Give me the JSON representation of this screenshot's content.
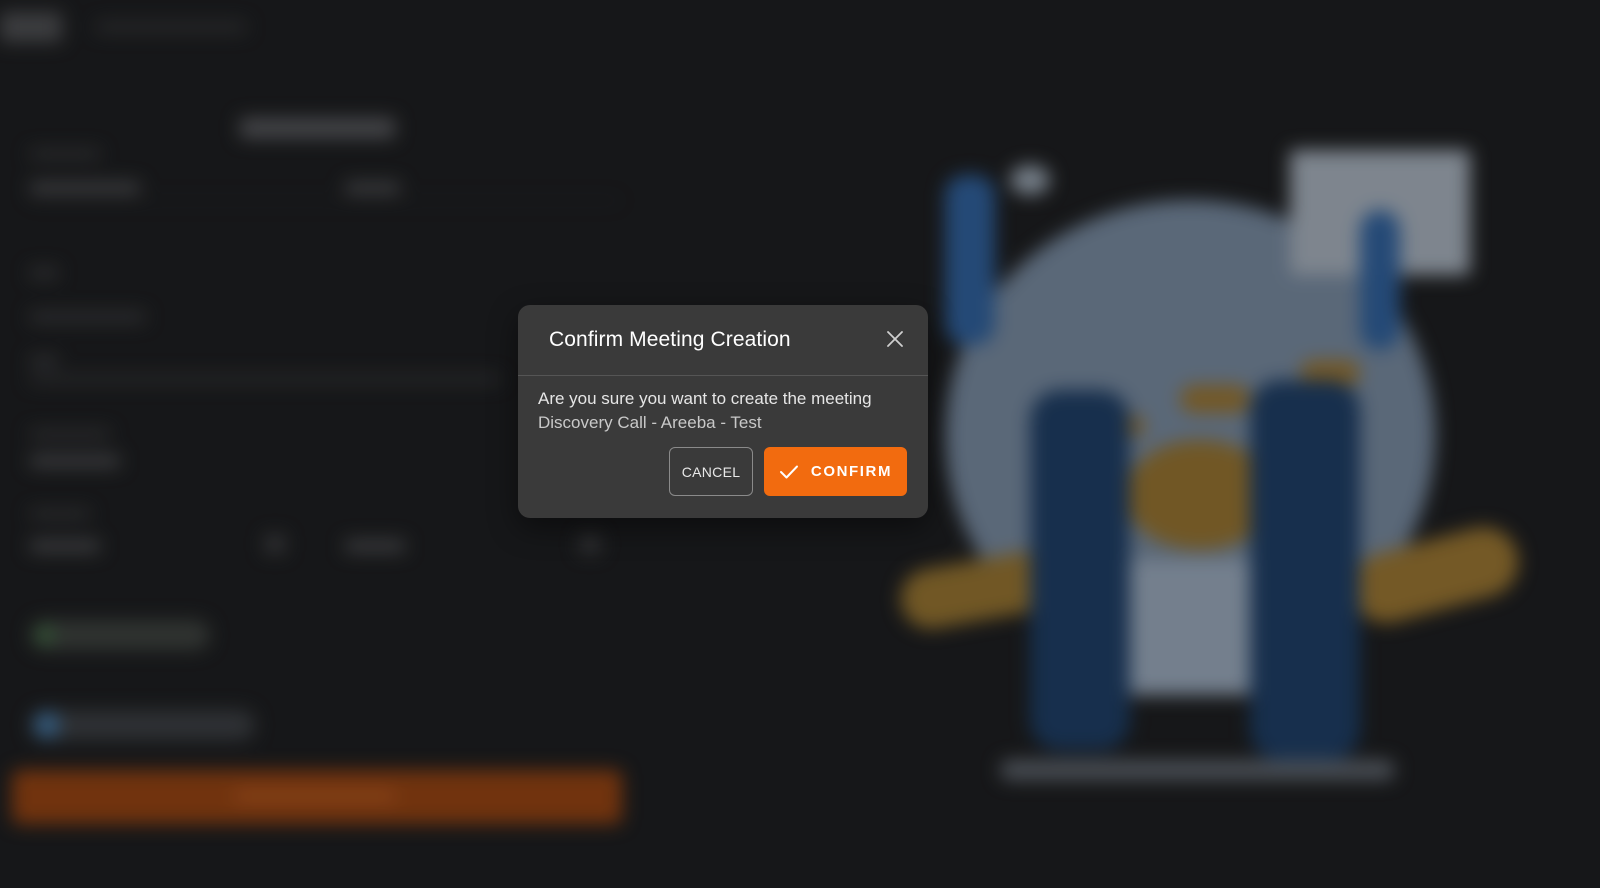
{
  "dialog": {
    "title": "Confirm Meeting Creation",
    "question": "Are you sure you want to create the meeting",
    "meeting_name": "Discovery Call - Areeba - Test",
    "cancel_label": "CANCEL",
    "confirm_label": "CONFIRM",
    "close_icon": "close-icon",
    "confirm_icon": "check-icon"
  },
  "colors": {
    "accent": "#f26b0f",
    "dialog_bg": "#3a3a3a",
    "page_bg": "#1c1d1f"
  }
}
